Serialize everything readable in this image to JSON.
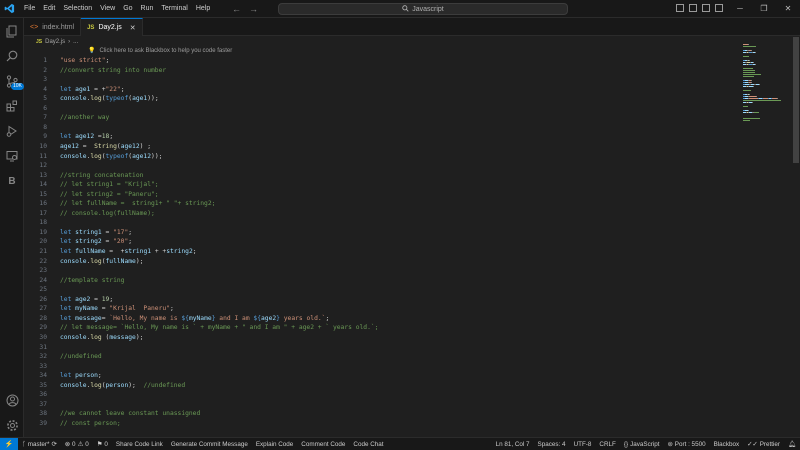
{
  "menu": [
    "File",
    "Edit",
    "Selection",
    "View",
    "Go",
    "Run",
    "Terminal",
    "Help"
  ],
  "search": {
    "text": "Javascript"
  },
  "activity": {
    "badge": "10K"
  },
  "tabs": [
    {
      "label": "index.html",
      "icon": "html-icon",
      "active": false
    },
    {
      "label": "Day2.js",
      "icon": "js-icon",
      "active": true
    }
  ],
  "breadcrumb": {
    "file": "Day2.js",
    "rest": "..."
  },
  "hint": {
    "text": "Click here to ask Blackbox to help you code faster"
  },
  "code": [
    {
      "n": "1",
      "tokens": [
        [
          "str",
          "\"use strict\""
        ],
        [
          "pl",
          ";"
        ]
      ]
    },
    {
      "n": "2",
      "tokens": [
        [
          "cm",
          "//convert string into number"
        ]
      ]
    },
    {
      "n": "3",
      "tokens": []
    },
    {
      "n": "4",
      "tokens": [
        [
          "kw",
          "let "
        ],
        [
          "var",
          "age1"
        ],
        [
          "pl",
          " = +"
        ],
        [
          "str",
          "\"22\""
        ],
        [
          "pl",
          ";"
        ]
      ]
    },
    {
      "n": "5",
      "tokens": [
        [
          "var",
          "console"
        ],
        [
          "pl",
          "."
        ],
        [
          "fn",
          "log"
        ],
        [
          "pl",
          "("
        ],
        [
          "kw",
          "typeof"
        ],
        [
          "pl",
          "("
        ],
        [
          "var",
          "age1"
        ],
        [
          "pl",
          "));"
        ]
      ]
    },
    {
      "n": "6",
      "tokens": []
    },
    {
      "n": "7",
      "tokens": [
        [
          "cm",
          "//another way"
        ]
      ]
    },
    {
      "n": "8",
      "tokens": []
    },
    {
      "n": "9",
      "tokens": [
        [
          "kw",
          "let "
        ],
        [
          "var",
          "age12"
        ],
        [
          "pl",
          " ="
        ],
        [
          "num",
          "18"
        ],
        [
          "pl",
          ";"
        ]
      ]
    },
    {
      "n": "10",
      "tokens": [
        [
          "var",
          "age12"
        ],
        [
          "pl",
          " =  "
        ],
        [
          "fn",
          "String"
        ],
        [
          "pl",
          "("
        ],
        [
          "var",
          "age12"
        ],
        [
          "pl",
          ") ;"
        ]
      ]
    },
    {
      "n": "11",
      "tokens": [
        [
          "var",
          "console"
        ],
        [
          "pl",
          "."
        ],
        [
          "fn",
          "log"
        ],
        [
          "pl",
          "("
        ],
        [
          "kw",
          "typeof"
        ],
        [
          "pl",
          "("
        ],
        [
          "var",
          "age12"
        ],
        [
          "pl",
          "));"
        ]
      ]
    },
    {
      "n": "12",
      "tokens": []
    },
    {
      "n": "13",
      "tokens": [
        [
          "cm",
          "//string concatenation"
        ]
      ]
    },
    {
      "n": "14",
      "tokens": [
        [
          "cm",
          "// let string1 = \"Krijal\";"
        ]
      ]
    },
    {
      "n": "15",
      "tokens": [
        [
          "cm",
          "// let string2 = \"Paneru\";"
        ]
      ]
    },
    {
      "n": "16",
      "tokens": [
        [
          "cm",
          "// let fullName =  string1+ \" \"+ string2;"
        ]
      ]
    },
    {
      "n": "17",
      "tokens": [
        [
          "cm",
          "// console.log(fullName);"
        ]
      ]
    },
    {
      "n": "18",
      "tokens": []
    },
    {
      "n": "19",
      "tokens": [
        [
          "kw",
          "let "
        ],
        [
          "var",
          "string1"
        ],
        [
          "pl",
          " = "
        ],
        [
          "str",
          "\"17\""
        ],
        [
          "pl",
          ";"
        ]
      ]
    },
    {
      "n": "20",
      "tokens": [
        [
          "kw",
          "let "
        ],
        [
          "var",
          "string2"
        ],
        [
          "pl",
          " = "
        ],
        [
          "str",
          "\"20\""
        ],
        [
          "pl",
          ";"
        ]
      ]
    },
    {
      "n": "21",
      "tokens": [
        [
          "kw",
          "let "
        ],
        [
          "var",
          "fullName"
        ],
        [
          "pl",
          " =  +"
        ],
        [
          "var",
          "string1"
        ],
        [
          "pl",
          " + +"
        ],
        [
          "var",
          "string2"
        ],
        [
          "pl",
          ";"
        ]
      ]
    },
    {
      "n": "22",
      "tokens": [
        [
          "var",
          "console"
        ],
        [
          "pl",
          "."
        ],
        [
          "fn",
          "log"
        ],
        [
          "pl",
          "("
        ],
        [
          "var",
          "fullName"
        ],
        [
          "pl",
          ");"
        ]
      ]
    },
    {
      "n": "23",
      "tokens": []
    },
    {
      "n": "24",
      "tokens": [
        [
          "cm",
          "//template string"
        ]
      ]
    },
    {
      "n": "25",
      "tokens": []
    },
    {
      "n": "26",
      "tokens": [
        [
          "kw",
          "let "
        ],
        [
          "var",
          "age2"
        ],
        [
          "pl",
          " = "
        ],
        [
          "num",
          "19"
        ],
        [
          "pl",
          ";"
        ]
      ]
    },
    {
      "n": "27",
      "tokens": [
        [
          "kw",
          "let "
        ],
        [
          "var",
          "myName"
        ],
        [
          "pl",
          " = "
        ],
        [
          "str",
          "\"Krijal  Paneru\""
        ],
        [
          "pl",
          ";"
        ]
      ]
    },
    {
      "n": "28",
      "tokens": [
        [
          "kw",
          "let "
        ],
        [
          "var",
          "message"
        ],
        [
          "pl",
          "= "
        ],
        [
          "str",
          "`Hello, My name is "
        ],
        [
          "tpl",
          "${"
        ],
        [
          "var",
          "myName"
        ],
        [
          "tpl",
          "}"
        ],
        [
          "str",
          " and I am "
        ],
        [
          "tpl",
          "${"
        ],
        [
          "var",
          "age2"
        ],
        [
          "tpl",
          "}"
        ],
        [
          "str",
          " years old.`"
        ],
        [
          "pl",
          ";"
        ]
      ]
    },
    {
      "n": "29",
      "tokens": [
        [
          "cm",
          "// let message= `Hello, My name is ` + myName + \" and I am \" + age2 + ` years old.`;"
        ]
      ]
    },
    {
      "n": "30",
      "tokens": [
        [
          "var",
          "console"
        ],
        [
          "pl",
          "."
        ],
        [
          "fn",
          "log"
        ],
        [
          "pl",
          " ("
        ],
        [
          "var",
          "message"
        ],
        [
          "pl",
          ");"
        ]
      ]
    },
    {
      "n": "31",
      "tokens": []
    },
    {
      "n": "32",
      "tokens": [
        [
          "cm",
          "//undefined"
        ]
      ]
    },
    {
      "n": "33",
      "tokens": []
    },
    {
      "n": "34",
      "tokens": [
        [
          "kw",
          "let "
        ],
        [
          "var",
          "person"
        ],
        [
          "pl",
          ";"
        ]
      ]
    },
    {
      "n": "35",
      "tokens": [
        [
          "var",
          "console"
        ],
        [
          "pl",
          "."
        ],
        [
          "fn",
          "log"
        ],
        [
          "pl",
          "("
        ],
        [
          "var",
          "person"
        ],
        [
          "pl",
          ");  "
        ],
        [
          "cm",
          "//undefined"
        ]
      ]
    },
    {
      "n": "36",
      "tokens": []
    },
    {
      "n": "37",
      "tokens": []
    },
    {
      "n": "38",
      "tokens": [
        [
          "cm",
          "//we cannot leave constant unassigned"
        ]
      ]
    },
    {
      "n": "39",
      "tokens": [
        [
          "cm",
          "// const person;"
        ]
      ]
    }
  ],
  "status": {
    "branch": "master*",
    "errors": "0",
    "warnings": "0",
    "ports": "0",
    "share": "Share Code Link",
    "generate": "Generate Commit Message",
    "explain": "Explain Code",
    "comment": "Comment Code",
    "chat": "Code Chat",
    "position": "Ln 81, Col 7",
    "spaces": "Spaces: 4",
    "encoding": "UTF-8",
    "eol": "CRLF",
    "language": "JavaScript",
    "port": "Port : 5500",
    "blackbox": "Blackbox",
    "prettier": "Prettier"
  },
  "colors": {
    "accent": "#0078d4",
    "string": "#ce9178",
    "comment": "#6a9955",
    "keyword": "#569cd6",
    "variable": "#9cdcfe",
    "function": "#dcdcaa",
    "number": "#b5cea8"
  }
}
